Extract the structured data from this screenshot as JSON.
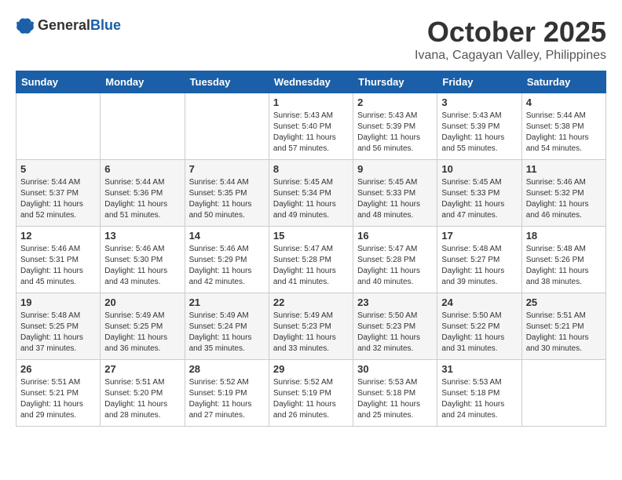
{
  "header": {
    "logo_general": "General",
    "logo_blue": "Blue",
    "month": "October 2025",
    "location": "Ivana, Cagayan Valley, Philippines"
  },
  "days_of_week": [
    "Sunday",
    "Monday",
    "Tuesday",
    "Wednesday",
    "Thursday",
    "Friday",
    "Saturday"
  ],
  "weeks": [
    [
      {
        "day": "",
        "info": ""
      },
      {
        "day": "",
        "info": ""
      },
      {
        "day": "",
        "info": ""
      },
      {
        "day": "1",
        "info": "Sunrise: 5:43 AM\nSunset: 5:40 PM\nDaylight: 11 hours and 57 minutes."
      },
      {
        "day": "2",
        "info": "Sunrise: 5:43 AM\nSunset: 5:39 PM\nDaylight: 11 hours and 56 minutes."
      },
      {
        "day": "3",
        "info": "Sunrise: 5:43 AM\nSunset: 5:39 PM\nDaylight: 11 hours and 55 minutes."
      },
      {
        "day": "4",
        "info": "Sunrise: 5:44 AM\nSunset: 5:38 PM\nDaylight: 11 hours and 54 minutes."
      }
    ],
    [
      {
        "day": "5",
        "info": "Sunrise: 5:44 AM\nSunset: 5:37 PM\nDaylight: 11 hours and 52 minutes."
      },
      {
        "day": "6",
        "info": "Sunrise: 5:44 AM\nSunset: 5:36 PM\nDaylight: 11 hours and 51 minutes."
      },
      {
        "day": "7",
        "info": "Sunrise: 5:44 AM\nSunset: 5:35 PM\nDaylight: 11 hours and 50 minutes."
      },
      {
        "day": "8",
        "info": "Sunrise: 5:45 AM\nSunset: 5:34 PM\nDaylight: 11 hours and 49 minutes."
      },
      {
        "day": "9",
        "info": "Sunrise: 5:45 AM\nSunset: 5:33 PM\nDaylight: 11 hours and 48 minutes."
      },
      {
        "day": "10",
        "info": "Sunrise: 5:45 AM\nSunset: 5:33 PM\nDaylight: 11 hours and 47 minutes."
      },
      {
        "day": "11",
        "info": "Sunrise: 5:46 AM\nSunset: 5:32 PM\nDaylight: 11 hours and 46 minutes."
      }
    ],
    [
      {
        "day": "12",
        "info": "Sunrise: 5:46 AM\nSunset: 5:31 PM\nDaylight: 11 hours and 45 minutes."
      },
      {
        "day": "13",
        "info": "Sunrise: 5:46 AM\nSunset: 5:30 PM\nDaylight: 11 hours and 43 minutes."
      },
      {
        "day": "14",
        "info": "Sunrise: 5:46 AM\nSunset: 5:29 PM\nDaylight: 11 hours and 42 minutes."
      },
      {
        "day": "15",
        "info": "Sunrise: 5:47 AM\nSunset: 5:28 PM\nDaylight: 11 hours and 41 minutes."
      },
      {
        "day": "16",
        "info": "Sunrise: 5:47 AM\nSunset: 5:28 PM\nDaylight: 11 hours and 40 minutes."
      },
      {
        "day": "17",
        "info": "Sunrise: 5:48 AM\nSunset: 5:27 PM\nDaylight: 11 hours and 39 minutes."
      },
      {
        "day": "18",
        "info": "Sunrise: 5:48 AM\nSunset: 5:26 PM\nDaylight: 11 hours and 38 minutes."
      }
    ],
    [
      {
        "day": "19",
        "info": "Sunrise: 5:48 AM\nSunset: 5:25 PM\nDaylight: 11 hours and 37 minutes."
      },
      {
        "day": "20",
        "info": "Sunrise: 5:49 AM\nSunset: 5:25 PM\nDaylight: 11 hours and 36 minutes."
      },
      {
        "day": "21",
        "info": "Sunrise: 5:49 AM\nSunset: 5:24 PM\nDaylight: 11 hours and 35 minutes."
      },
      {
        "day": "22",
        "info": "Sunrise: 5:49 AM\nSunset: 5:23 PM\nDaylight: 11 hours and 33 minutes."
      },
      {
        "day": "23",
        "info": "Sunrise: 5:50 AM\nSunset: 5:23 PM\nDaylight: 11 hours and 32 minutes."
      },
      {
        "day": "24",
        "info": "Sunrise: 5:50 AM\nSunset: 5:22 PM\nDaylight: 11 hours and 31 minutes."
      },
      {
        "day": "25",
        "info": "Sunrise: 5:51 AM\nSunset: 5:21 PM\nDaylight: 11 hours and 30 minutes."
      }
    ],
    [
      {
        "day": "26",
        "info": "Sunrise: 5:51 AM\nSunset: 5:21 PM\nDaylight: 11 hours and 29 minutes."
      },
      {
        "day": "27",
        "info": "Sunrise: 5:51 AM\nSunset: 5:20 PM\nDaylight: 11 hours and 28 minutes."
      },
      {
        "day": "28",
        "info": "Sunrise: 5:52 AM\nSunset: 5:19 PM\nDaylight: 11 hours and 27 minutes."
      },
      {
        "day": "29",
        "info": "Sunrise: 5:52 AM\nSunset: 5:19 PM\nDaylight: 11 hours and 26 minutes."
      },
      {
        "day": "30",
        "info": "Sunrise: 5:53 AM\nSunset: 5:18 PM\nDaylight: 11 hours and 25 minutes."
      },
      {
        "day": "31",
        "info": "Sunrise: 5:53 AM\nSunset: 5:18 PM\nDaylight: 11 hours and 24 minutes."
      },
      {
        "day": "",
        "info": ""
      }
    ]
  ]
}
